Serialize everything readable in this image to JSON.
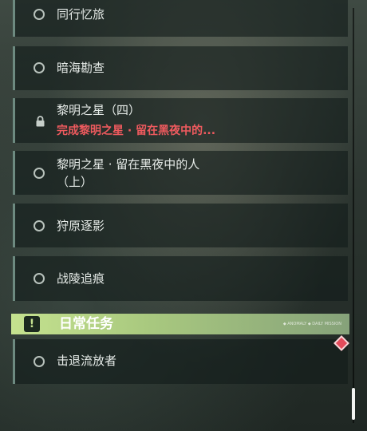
{
  "quests": [
    {
      "title": "同行忆旅",
      "state": "available"
    },
    {
      "title": "暗海勘查",
      "state": "available"
    },
    {
      "title": "黎明之星（四）",
      "state": "locked",
      "subtitle": "完成黎明之星 · 留在黑夜中的..."
    },
    {
      "title": "黎明之星 · 留在黑夜中的人（上）",
      "title_line1": "黎明之星 · 留在黑夜中的人",
      "title_line2": "（上）",
      "state": "available"
    },
    {
      "title": "狩原逐影",
      "state": "available"
    },
    {
      "title": "战陵追痕",
      "state": "available"
    }
  ],
  "section": {
    "label": "日常任务",
    "badge": "!",
    "small_text": "◆ ANOMALY ◆ DAILY MISSION"
  },
  "daily_quests": [
    {
      "title": "击退流放者",
      "state": "available"
    }
  ],
  "colors": {
    "accent_green": "#c5e28f",
    "alert_red": "#ee5a5e",
    "marker_red": "#e24b5b"
  }
}
